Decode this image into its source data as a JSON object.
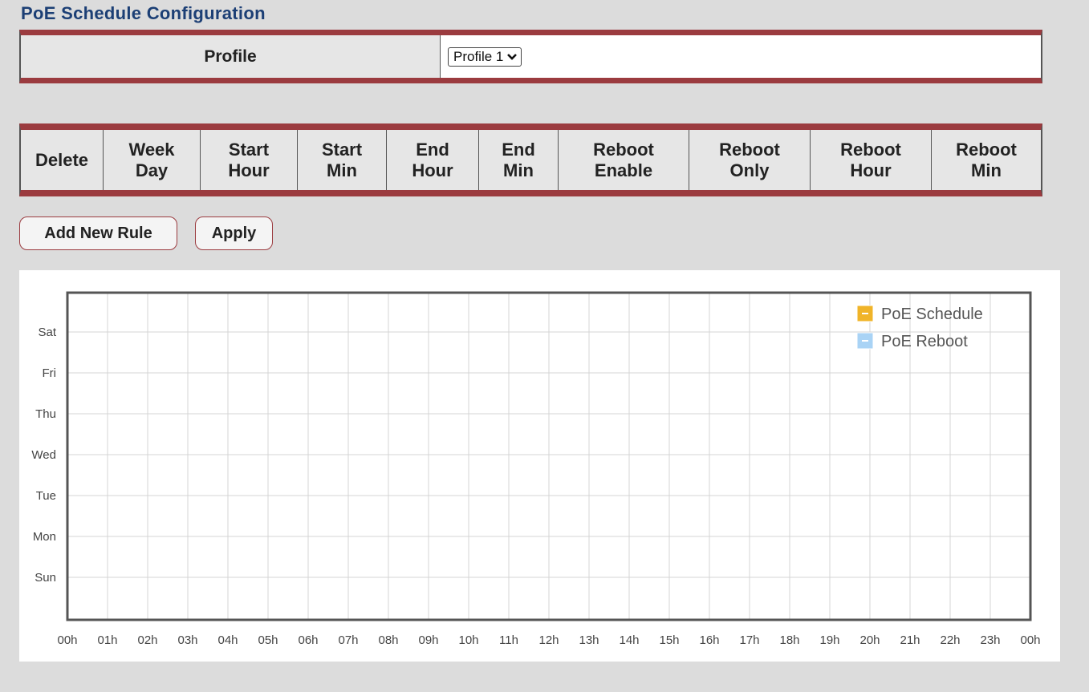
{
  "page": {
    "title": "PoE Schedule Configuration"
  },
  "profile": {
    "label": "Profile",
    "selected": "Profile 1"
  },
  "rules": {
    "headers": [
      [
        "Delete"
      ],
      [
        "Week",
        "Day"
      ],
      [
        "Start",
        "Hour"
      ],
      [
        "Start",
        "Min"
      ],
      [
        "End",
        "Hour"
      ],
      [
        "End",
        "Min"
      ],
      [
        "Reboot",
        "Enable"
      ],
      [
        "Reboot",
        "Only"
      ],
      [
        "Reboot",
        "Hour"
      ],
      [
        "Reboot",
        "Min"
      ]
    ]
  },
  "buttons": {
    "add_rule": "Add New Rule",
    "apply": "Apply"
  },
  "chart_data": {
    "type": "bar",
    "orientation": "horizontal-timeline",
    "categories": [
      "Sun",
      "Mon",
      "Tue",
      "Wed",
      "Thu",
      "Fri",
      "Sat"
    ],
    "x_ticks": [
      "00h",
      "01h",
      "02h",
      "03h",
      "04h",
      "05h",
      "06h",
      "07h",
      "08h",
      "09h",
      "10h",
      "11h",
      "12h",
      "13h",
      "14h",
      "15h",
      "16h",
      "17h",
      "18h",
      "19h",
      "20h",
      "21h",
      "22h",
      "23h",
      "00h"
    ],
    "xlim": [
      0,
      24
    ],
    "series": [
      {
        "name": "PoE Schedule",
        "color": "#f0b429",
        "values": []
      },
      {
        "name": "PoE Reboot",
        "color": "#a9d3f5",
        "values": []
      }
    ],
    "legend": "top-right",
    "grid": true
  }
}
